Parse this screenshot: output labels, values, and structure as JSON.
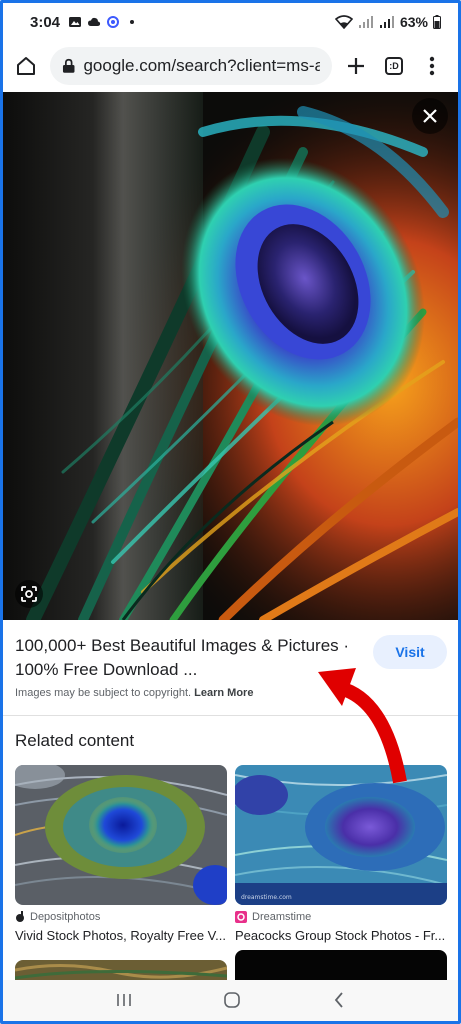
{
  "status_bar": {
    "time": "3:04",
    "battery": "63%"
  },
  "browser": {
    "url": "google.com/search?client=ms-ar",
    "tab_count": ":D",
    "icons": [
      "home-icon",
      "lock-icon",
      "new-tab-icon",
      "tab-switcher-icon",
      "more-icon"
    ]
  },
  "result": {
    "title_line1": "100,000+ Best Beautiful Images & Pictures ·",
    "title_line2": "100% Free Download ...",
    "visit_label": "Visit",
    "copyright_text": "Images may be subject to copyright.",
    "learn_more": "Learn More"
  },
  "related": {
    "heading": "Related content",
    "cards": [
      {
        "source": "Depositphotos",
        "title": "Vivid Stock Photos, Royalty Free V..."
      },
      {
        "source": "Dreamstime",
        "title": "Peacocks Group Stock Photos - Fr..."
      }
    ]
  },
  "colors": {
    "accent": "#1a73e8",
    "visit_bg": "#e8f0fe",
    "annotation_arrow": "#e00000"
  }
}
